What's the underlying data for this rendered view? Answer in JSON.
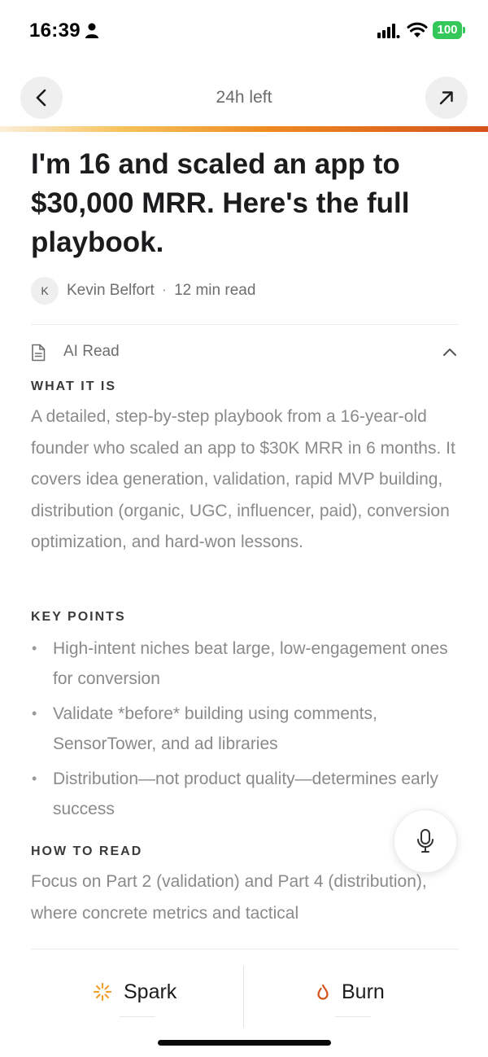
{
  "status_bar": {
    "time": "16:39",
    "battery": "100",
    "icons": [
      "person-icon",
      "signal-icon",
      "wifi-icon",
      "battery-icon"
    ]
  },
  "nav": {
    "title": "24h left",
    "back_icon": "chevron-left-icon",
    "open_icon": "arrow-up-right-icon"
  },
  "reading_progress": 1.0,
  "colors": {
    "progress_start": "#fbefd9",
    "progress_end": "#d4521a",
    "spark_accent": "#f0a030",
    "burn_accent": "#d4521a",
    "battery": "#34c759"
  },
  "article": {
    "title": "I'm 16 and scaled an app to $30,000 MRR. Here's the full playbook.",
    "author_initial": "K",
    "author": "Kevin Belfort",
    "separator": "·",
    "read_time": "12 min read"
  },
  "ai_read": {
    "label": "AI Read",
    "what_it_is": {
      "heading": "WHAT IT IS",
      "text": "A detailed, step-by-step playbook from a 16-year-old founder who scaled an app to $30K MRR in 6 months. It covers idea generation, validation, rapid MVP building, distribution (organic, UGC, influencer, paid), conversion optimization, and hard-won lessons."
    },
    "key_points": {
      "heading": "KEY POINTS",
      "items": [
        "High-intent niches beat large, low-engagement ones for conversion",
        "Validate *before* building using comments, SensorTower, and ad libraries",
        "Distribution—not product quality—determines early success"
      ]
    },
    "how_to_read": {
      "heading": "HOW TO READ",
      "text": "Focus on Part 2 (validation) and Part 4 (distribution), where concrete metrics and tactical"
    }
  },
  "actions": {
    "spark_label": "Spark",
    "burn_label": "Burn"
  }
}
